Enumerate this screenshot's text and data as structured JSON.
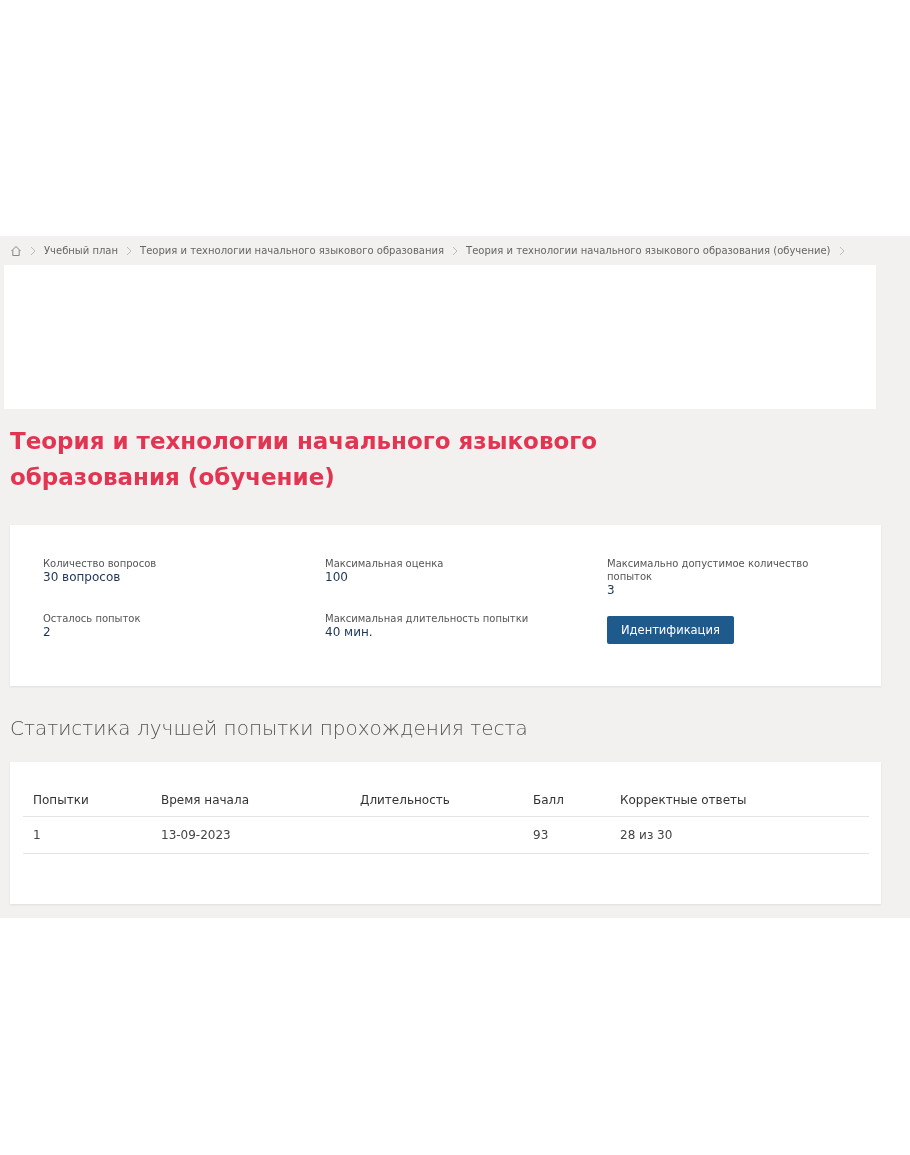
{
  "breadcrumb": [
    "Учебный план",
    "Теория и технологии начального языкового образования",
    "Теория и технологии начального языкового образования (обучение)"
  ],
  "title": "Теория и технологии начального языкового образования (обучение)",
  "info": [
    {
      "label": "Количество вопросов",
      "value": "30 вопросов"
    },
    {
      "label": "Максимальная оценка",
      "value": "100"
    },
    {
      "label": "Максимально допустимое количество попыток",
      "value": "3"
    },
    {
      "label": "Осталось попыток",
      "value": "2"
    },
    {
      "label": "Максимальная длительность попытки",
      "value": "40 мин."
    }
  ],
  "identify_button": "Идентификация",
  "stats_heading": "Статистика лучшей попытки прохождения теста",
  "table": {
    "columns": [
      "Попытки",
      "Время начала",
      "Длительность",
      "Балл",
      "Корректные ответы"
    ],
    "rows": [
      [
        "1",
        "13-09-2023",
        "",
        "93",
        "28 из 30"
      ]
    ]
  }
}
